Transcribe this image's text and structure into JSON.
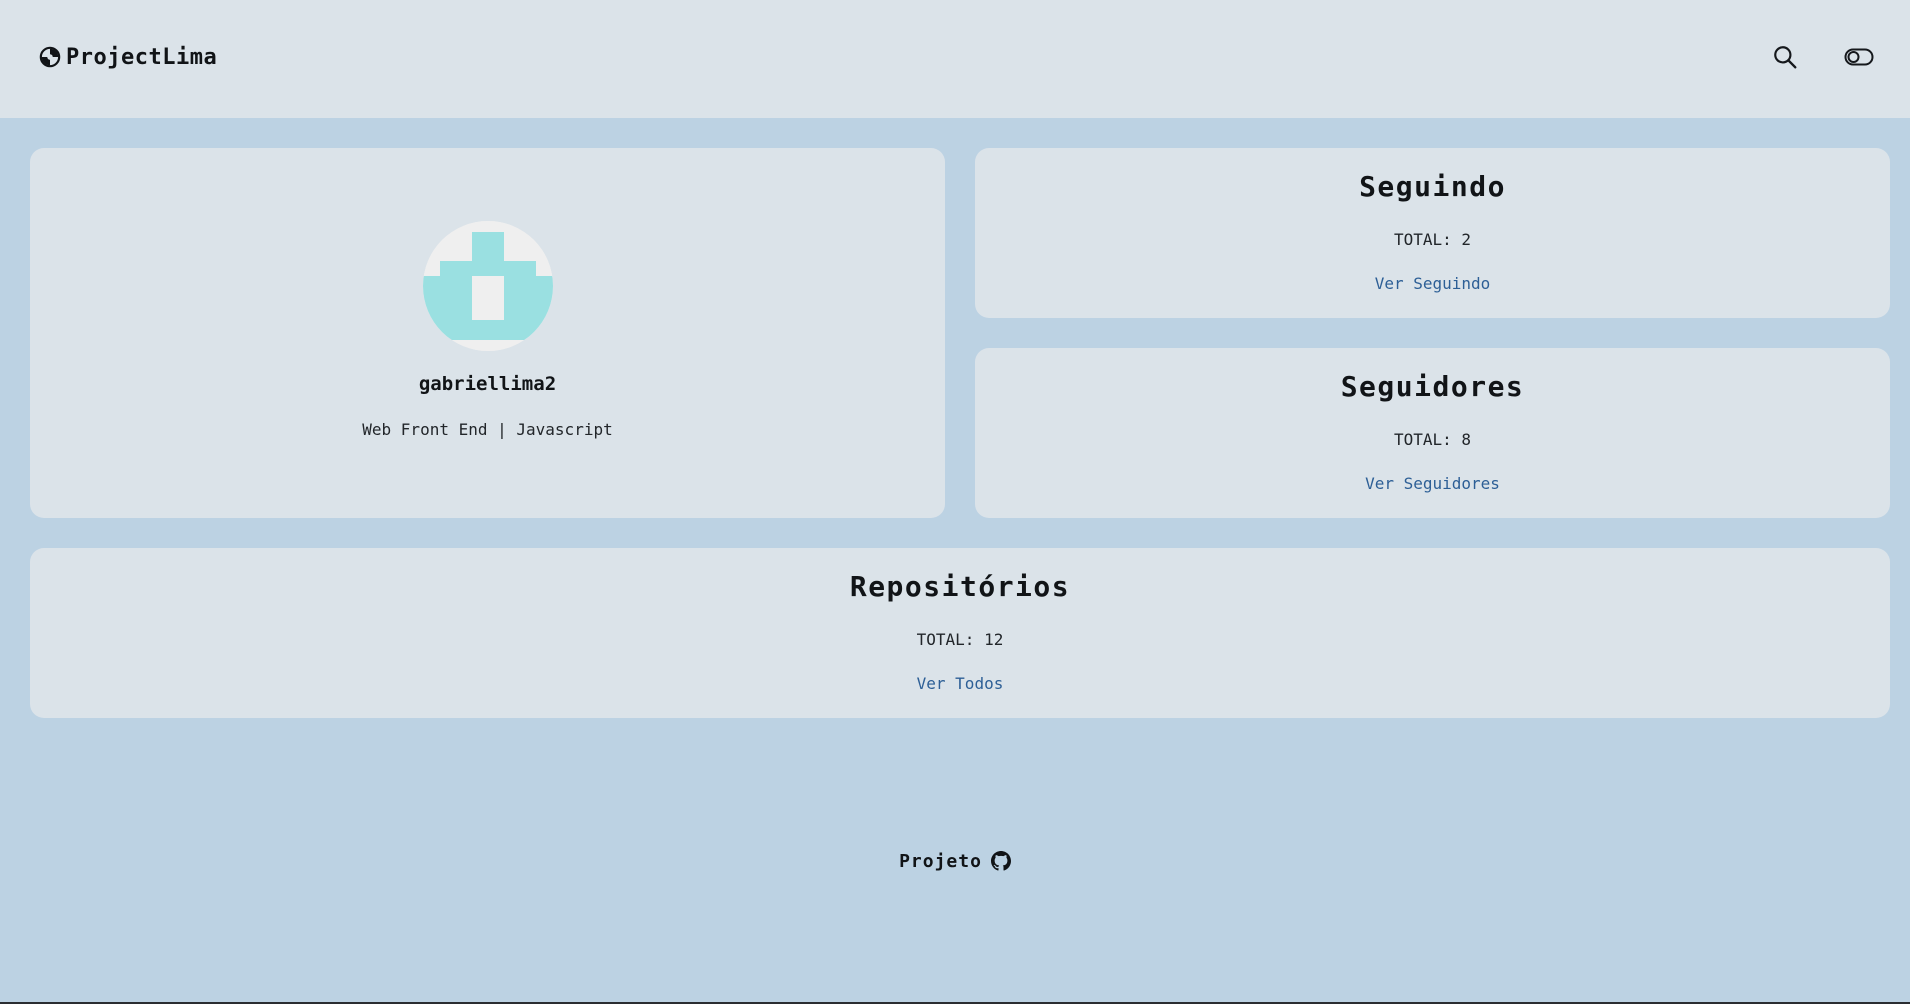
{
  "header": {
    "brand_name": "ProjectLima",
    "brand_icon": "spiral-logo-icon",
    "search_icon": "search-icon",
    "theme_toggle_icon": "theme-toggle-icon"
  },
  "profile": {
    "username": "gabriellima2",
    "bio": "Web Front End | Javascript",
    "avatar_colors": {
      "primary": "#9ae0e1",
      "background": "#efefef"
    }
  },
  "following": {
    "title": "Seguindo",
    "total_label": "TOTAL: 2",
    "link_label": "Ver Seguindo"
  },
  "followers": {
    "title": "Seguidores",
    "total_label": "TOTAL: 8",
    "link_label": "Ver Seguidores"
  },
  "repositories": {
    "title": "Repositórios",
    "total_label": "TOTAL: 12",
    "link_label": "Ver Todos"
  },
  "footer": {
    "label": "Projeto",
    "icon": "github-icon"
  },
  "colors": {
    "page_background": "#bcd2e3",
    "card_background": "#dbe3e9",
    "link": "#2d5f96",
    "text": "#111417"
  }
}
